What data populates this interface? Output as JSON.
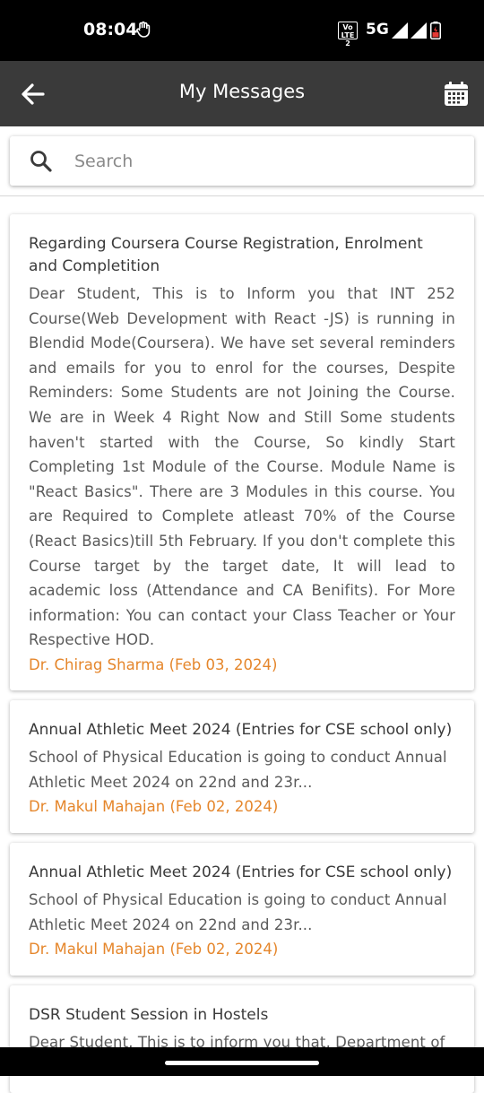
{
  "status": {
    "time": "08:04",
    "volte": "Vo LTE 2",
    "network": "5G"
  },
  "header": {
    "title": "My Messages"
  },
  "search": {
    "placeholder": "Search"
  },
  "messages": [
    {
      "title": "Regarding Coursera Course Registration, Enrolment and Completition",
      "body": "Dear Student, This is to Inform you that INT 252 Course(Web Development with React -JS) is running in Blendid Mode(Coursera). We have set several reminders and emails for you to enrol for the courses, Despite Reminders: Some Students are not Joining the Course. We are in Week 4 Right Now and Still Some students haven't started with the Course, So kindly Start Completing 1st Module of the Course. Module Name is \"React Basics\". There are 3 Modules in this course. You are Required to Complete atleast 70% of the Course (React Basics)till 5th February. If you don't complete this Course target by the target date, It will lead to academic loss (Attendance and CA Benifits). For More information: You can contact your Class Teacher or Your Respective HOD.",
      "author": "Dr. Chirag Sharma (Feb 03, 2024)"
    },
    {
      "title": "Annual Athletic Meet 2024 (Entries for CSE school only)",
      "body": "School of Physical Education is going to conduct Annual Athletic Meet 2024 on 22nd and 23r...",
      "author": "Dr. Makul Mahajan (Feb 02, 2024)"
    },
    {
      "title": "Annual Athletic Meet 2024 (Entries for CSE school only)",
      "body": "School of Physical Education is going to conduct Annual Athletic Meet 2024 on 22nd and 23r...",
      "author": "Dr. Makul Mahajan (Feb 02, 2024)"
    },
    {
      "title": "DSR Student Session in Hostels",
      "body": "Dear Student, This is to inform you that, Department of"
    }
  ],
  "colors": {
    "appbar": "#3a3a3a",
    "author": "#e5862b"
  }
}
